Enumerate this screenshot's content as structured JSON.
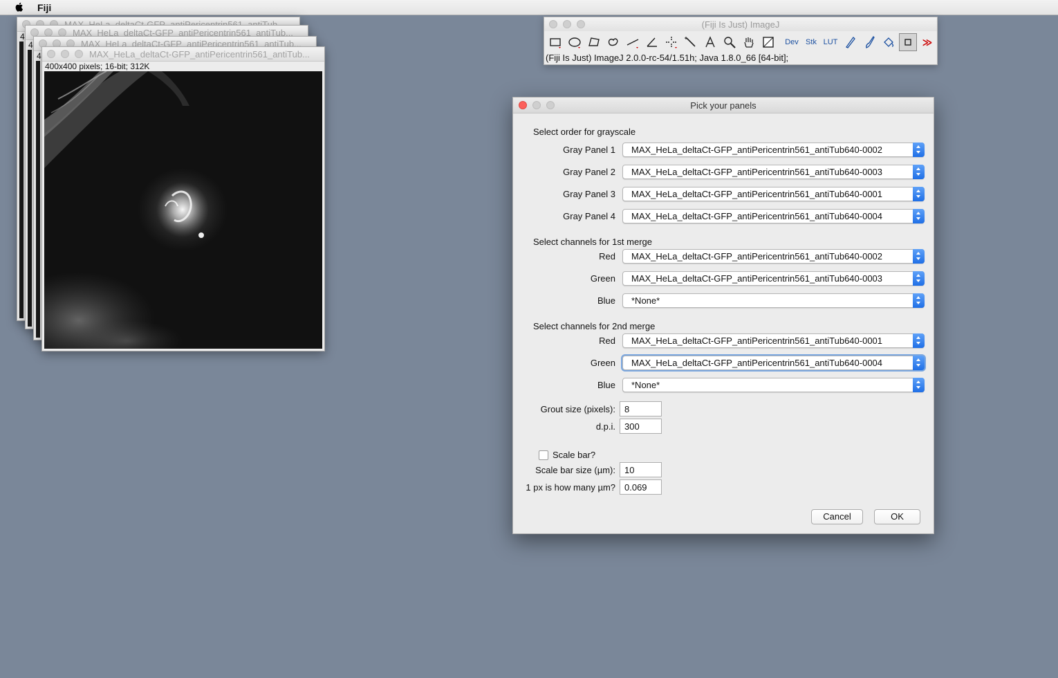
{
  "menubar": {
    "app_name": "Fiji",
    "apple_icon": "apple-logo-icon"
  },
  "image_windows": [
    {
      "title": "MAX_HeLa_deltaCt-GFP_antiPericentrin561_antiTub...",
      "info": "4"
    },
    {
      "title": "MAX_HeLa_deltaCt-GFP_antiPericentrin561_antiTub...",
      "info": "4"
    },
    {
      "title": "MAX_HeLa_deltaCt-GFP_antiPericentrin561_antiTub...",
      "info": "4"
    },
    {
      "title": "MAX_HeLa_deltaCt-GFP_antiPericentrin561_antiTub...",
      "info": "400x400 pixels; 16-bit; 312K"
    }
  ],
  "imagej": {
    "title": "(Fiji Is Just) ImageJ",
    "status": "(Fiji Is Just) ImageJ 2.0.0-rc-54/1.51h; Java 1.8.0_66 [64-bit];",
    "tools": [
      "rectangle-tool",
      "oval-tool",
      "polygon-tool",
      "freehand-tool",
      "line-tool",
      "angle-tool",
      "point-tool",
      "wand-tool",
      "text-tool",
      "magnifier-tool",
      "hand-tool",
      "color-picker-tool",
      "Dev",
      "Stk",
      "LUT",
      "pencil-tool",
      "brush-tool",
      "flood-fill-tool",
      "selection-rect-tool",
      "more-tools"
    ],
    "dev_label": "Dev",
    "stk_label": "Stk",
    "lut_label": "LUT",
    "more_label": "≫"
  },
  "dialog": {
    "title": "Pick your panels",
    "grayscale_header": "Select order for grayscale",
    "gray_panels": [
      {
        "label": "Gray Panel 1",
        "value": "MAX_HeLa_deltaCt-GFP_antiPericentrin561_antiTub640-0002"
      },
      {
        "label": "Gray Panel 2",
        "value": "MAX_HeLa_deltaCt-GFP_antiPericentrin561_antiTub640-0003"
      },
      {
        "label": "Gray Panel 3",
        "value": "MAX_HeLa_deltaCt-GFP_antiPericentrin561_antiTub640-0001"
      },
      {
        "label": "Gray Panel 4",
        "value": "MAX_HeLa_deltaCt-GFP_antiPericentrin561_antiTub640-0004"
      }
    ],
    "merge1_header": "Select channels for 1st merge",
    "merge1": [
      {
        "label": "Red",
        "value": "MAX_HeLa_deltaCt-GFP_antiPericentrin561_antiTub640-0002"
      },
      {
        "label": "Green",
        "value": "MAX_HeLa_deltaCt-GFP_antiPericentrin561_antiTub640-0003"
      },
      {
        "label": "Blue",
        "value": "*None*"
      }
    ],
    "merge2_header": "Select channels for 2nd merge",
    "merge2": [
      {
        "label": "Red",
        "value": "MAX_HeLa_deltaCt-GFP_antiPericentrin561_antiTub640-0001"
      },
      {
        "label": "Green",
        "value": "MAX_HeLa_deltaCt-GFP_antiPericentrin561_antiTub640-0004"
      },
      {
        "label": "Blue",
        "value": "*None*"
      }
    ],
    "grout_label": "Grout size (pixels):",
    "grout_value": "8",
    "dpi_label": "d.p.i.",
    "dpi_value": "300",
    "scalebar_label": "Scale bar?",
    "scalebar_checked": false,
    "scalebar_size_label": "Scale bar size (µm):",
    "scalebar_size_value": "10",
    "px_label": "1 px is how many µm?",
    "px_value": "0.069",
    "cancel_label": "Cancel",
    "ok_label": "OK"
  },
  "colors": {
    "desktop": "#7a8799",
    "accent": "#1f6fe6",
    "close_red": "#fc605b"
  }
}
